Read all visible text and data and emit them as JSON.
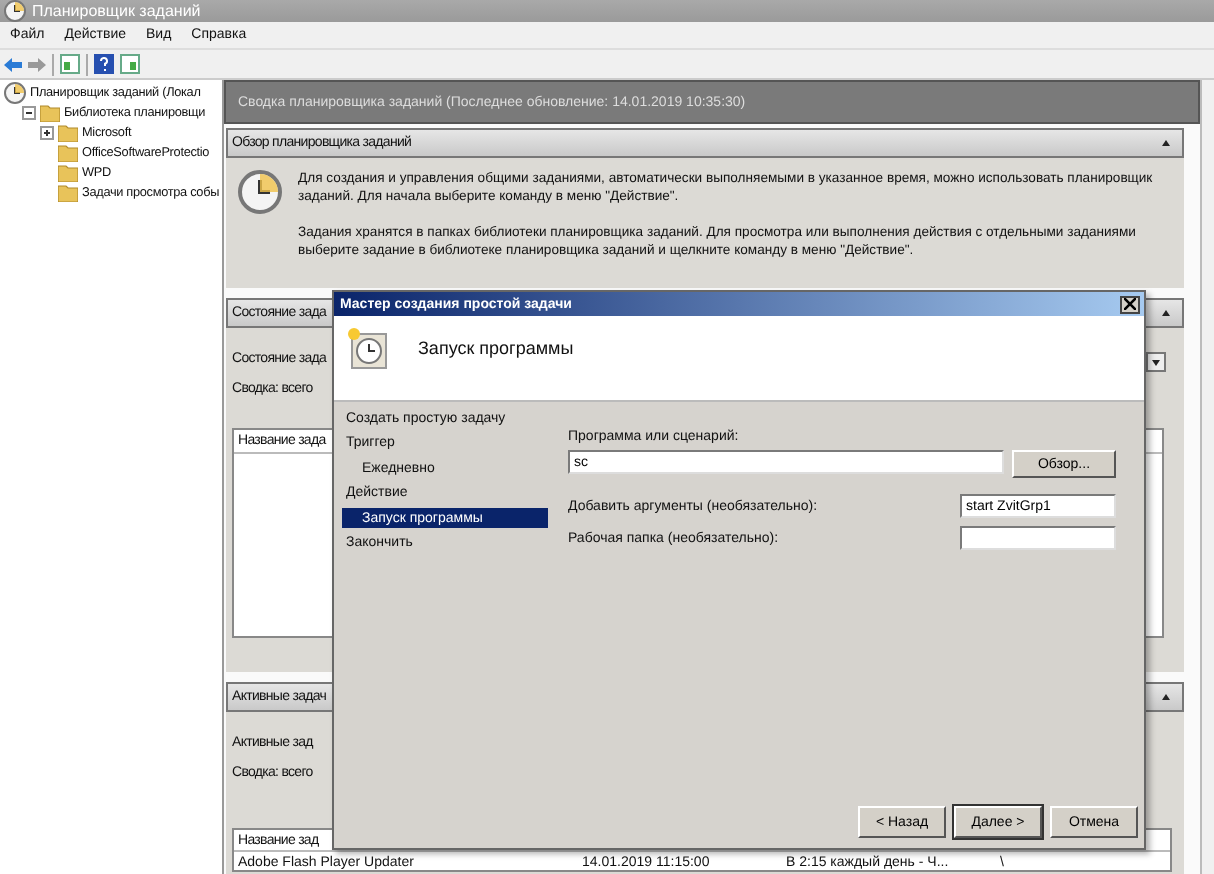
{
  "window": {
    "title": "Планировщик заданий"
  },
  "menu": [
    "Файл",
    "Действие",
    "Вид",
    "Справка"
  ],
  "tree": {
    "label": "Планировщик заданий (Локал",
    "children": [
      {
        "label": "Библиотека планировщи",
        "expanded": true,
        "children": [
          {
            "label": "Microsoft",
            "expanded": false
          },
          {
            "label": "OfficeSoftwareProtectio"
          },
          {
            "label": "WPD"
          },
          {
            "label": "Задачи просмотра собы"
          }
        ]
      }
    ]
  },
  "summary": {
    "header": "Сводка планировщика заданий (Последнее обновление: 14.01.2019 10:35:30)",
    "sections": [
      {
        "kind": "overview",
        "title": "Обзор планировщика заданий",
        "paragraphs": [
          "Для создания и управления общими заданиями, автоматически выполняемыми в указанное время, можно использовать планировщик заданий. Для начала выберите команду в меню \"Действие\".",
          "Задания хранятся в папках библиотеки планировщика заданий. Для просмотра или выполнения действия с отдельными заданиями выберите задание в библиотеке планировщика заданий и щелкните команду в меню \"Действие\"."
        ]
      },
      {
        "kind": "status",
        "title": "Состояние зада",
        "lines": [
          "Состояние зада",
          "Сводка: всего"
        ],
        "list_header": "Название зада"
      },
      {
        "kind": "active",
        "title": "Активные задач",
        "lines": [
          "Активные зад",
          "Сводка: всего"
        ],
        "table": {
          "columns": [
            "Название зад"
          ],
          "rows": [
            [
              "Adobe Flash Player Updater",
              "14.01.2019 11:15:00",
              "В 2:15 каждый день - Ч...",
              "\\"
            ]
          ]
        }
      }
    ]
  },
  "wizard": {
    "title": "Мастер создания простой задачи",
    "heading": "Запуск программы",
    "steps": [
      {
        "label": "Создать простую задачу",
        "selected": false
      },
      {
        "label": "Триггер",
        "selected": false,
        "children": [
          {
            "label": "Ежедневно",
            "selected": false
          }
        ]
      },
      {
        "label": "Действие",
        "selected": false,
        "children": [
          {
            "label": "Запуск программы",
            "selected": true
          }
        ]
      },
      {
        "label": "Закончить",
        "selected": false
      }
    ],
    "fields": [
      {
        "kind": "wide",
        "label": "Программа или сценарий:",
        "value": "sc",
        "button": "Обзор..."
      },
      {
        "kind": "inline",
        "label": "Добавить аргументы (необязательно):",
        "value": "start ZvitGrp1"
      },
      {
        "kind": "inline",
        "label": "Рабочая папка (необязательно):"
      }
    ],
    "buttons": [
      "< Назад",
      "Далее >",
      "Отмена"
    ]
  }
}
